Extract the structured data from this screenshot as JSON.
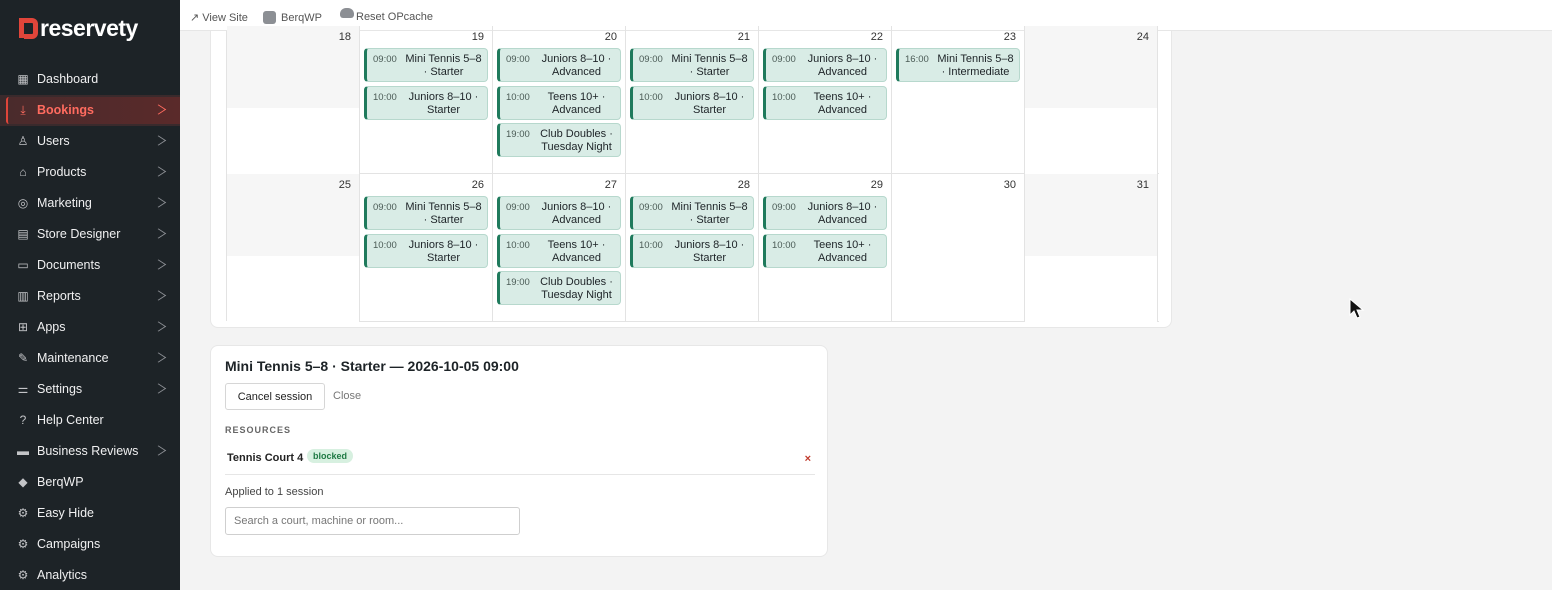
{
  "brand": {
    "name": "reservety",
    "accent": "#e0453a"
  },
  "sidebar": {
    "items": [
      {
        "label": "Dashboard",
        "icon": "dashboard-icon",
        "chevron": false,
        "active": false
      },
      {
        "label": "Bookings",
        "icon": "bookings-icon",
        "chevron": true,
        "active": true
      },
      {
        "label": "Users",
        "icon": "user-icon",
        "chevron": true,
        "active": false
      },
      {
        "label": "Products",
        "icon": "tag-icon",
        "chevron": true,
        "active": false
      },
      {
        "label": "Marketing",
        "icon": "marketing-icon",
        "chevron": true,
        "active": false
      },
      {
        "label": "Store Designer",
        "icon": "store-icon",
        "chevron": true,
        "active": false
      },
      {
        "label": "Documents",
        "icon": "documents-icon",
        "chevron": true,
        "active": false
      },
      {
        "label": "Reports",
        "icon": "reports-icon",
        "chevron": true,
        "active": false
      },
      {
        "label": "Apps",
        "icon": "apps-icon",
        "chevron": true,
        "active": false
      },
      {
        "label": "Maintenance",
        "icon": "wrench-icon",
        "chevron": true,
        "active": false
      },
      {
        "label": "Settings",
        "icon": "sliders-icon",
        "chevron": true,
        "active": false
      },
      {
        "label": "Help Center",
        "icon": "help-icon",
        "chevron": false,
        "active": false
      },
      {
        "label": "Business Reviews",
        "icon": "reviews-icon",
        "chevron": true,
        "active": false
      },
      {
        "label": "BerqWP",
        "icon": "berqwp-icon",
        "chevron": false,
        "active": false
      },
      {
        "label": "Easy Hide",
        "icon": "gear-icon",
        "chevron": false,
        "active": false
      },
      {
        "label": "Campaigns",
        "icon": "gear-icon",
        "chevron": false,
        "active": false
      },
      {
        "label": "Analytics",
        "icon": "gear-icon",
        "chevron": false,
        "active": false
      }
    ]
  },
  "topbar": {
    "view_site": "↗ View Site",
    "berqwp": "BerqWP",
    "reset_opcache": "Reset OPcache"
  },
  "calendar": {
    "weeks": [
      {
        "days": [
          {
            "num": "18",
            "weekend": true,
            "events": []
          },
          {
            "num": "19",
            "weekend": false,
            "events": [
              {
                "time": "09:00",
                "title": "Mini Tennis 5–8 · Starter"
              },
              {
                "time": "10:00",
                "title": "Juniors 8–10 · Starter"
              }
            ]
          },
          {
            "num": "20",
            "weekend": false,
            "events": [
              {
                "time": "09:00",
                "title": "Juniors 8–10 · Advanced"
              },
              {
                "time": "10:00",
                "title": "Teens 10+ · Advanced"
              },
              {
                "time": "19:00",
                "title": "Club Doubles · Tuesday Night"
              }
            ]
          },
          {
            "num": "21",
            "weekend": false,
            "events": [
              {
                "time": "09:00",
                "title": "Mini Tennis 5–8 · Starter"
              },
              {
                "time": "10:00",
                "title": "Juniors 8–10 · Starter"
              }
            ]
          },
          {
            "num": "22",
            "weekend": false,
            "events": [
              {
                "time": "09:00",
                "title": "Juniors 8–10 · Advanced"
              },
              {
                "time": "10:00",
                "title": "Teens 10+ · Advanced"
              }
            ]
          },
          {
            "num": "23",
            "weekend": false,
            "events": [
              {
                "time": "16:00",
                "title": "Mini Tennis 5–8 · Intermediate"
              }
            ]
          },
          {
            "num": "24",
            "weekend": true,
            "events": []
          }
        ]
      },
      {
        "days": [
          {
            "num": "25",
            "weekend": true,
            "events": []
          },
          {
            "num": "26",
            "weekend": false,
            "events": [
              {
                "time": "09:00",
                "title": "Mini Tennis 5–8 · Starter"
              },
              {
                "time": "10:00",
                "title": "Juniors 8–10 · Starter"
              }
            ]
          },
          {
            "num": "27",
            "weekend": false,
            "events": [
              {
                "time": "09:00",
                "title": "Juniors 8–10 · Advanced"
              },
              {
                "time": "10:00",
                "title": "Teens 10+ · Advanced"
              },
              {
                "time": "19:00",
                "title": "Club Doubles · Tuesday Night"
              }
            ]
          },
          {
            "num": "28",
            "weekend": false,
            "events": [
              {
                "time": "09:00",
                "title": "Mini Tennis 5–8 · Starter"
              },
              {
                "time": "10:00",
                "title": "Juniors 8–10 · Starter"
              }
            ]
          },
          {
            "num": "29",
            "weekend": false,
            "events": [
              {
                "time": "09:00",
                "title": "Juniors 8–10 · Advanced"
              },
              {
                "time": "10:00",
                "title": "Teens 10+ · Advanced"
              }
            ]
          },
          {
            "num": "30",
            "weekend": false,
            "events": []
          },
          {
            "num": "31",
            "weekend": true,
            "events": []
          }
        ]
      }
    ]
  },
  "detail": {
    "title": "Mini Tennis 5–8 · Starter — 2026-10-05 09:00",
    "cancel_label": "Cancel session",
    "close_label": "Close",
    "resources_label": "RESOURCES",
    "resource_name": "Tennis Court 4",
    "resource_badge": "blocked",
    "remove_symbol": "×",
    "applied_text": "Applied to 1 session",
    "search_placeholder": "Search a court, machine or room..."
  }
}
